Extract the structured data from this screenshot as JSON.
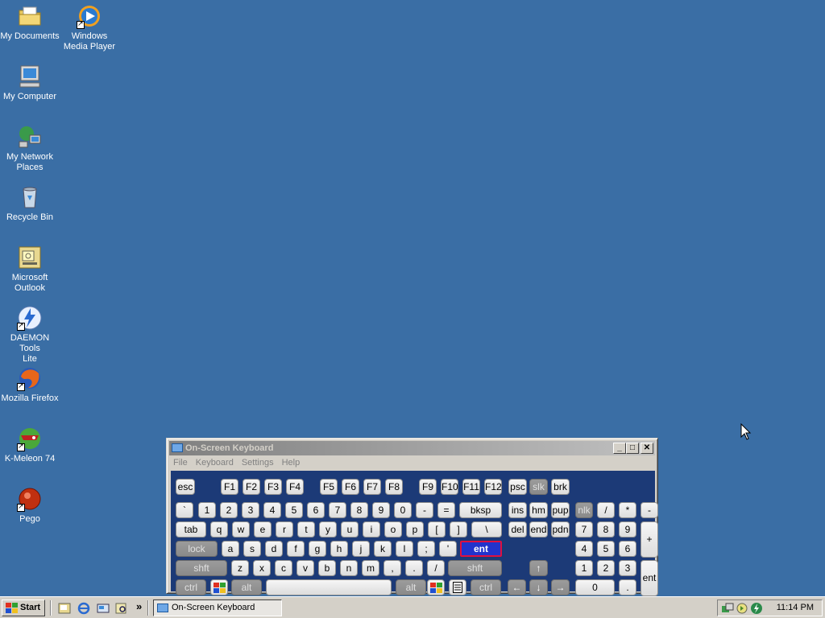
{
  "desktop": {
    "icons": [
      {
        "label": "My Documents"
      },
      {
        "label": "Windows\nMedia Player"
      },
      {
        "label": "My Computer"
      },
      {
        "label": "My Network\nPlaces"
      },
      {
        "label": "Recycle Bin"
      },
      {
        "label": "Microsoft\nOutlook"
      },
      {
        "label": "DAEMON Tools\nLite"
      },
      {
        "label": "Mozilla Firefox"
      },
      {
        "label": "K-Meleon 74"
      },
      {
        "label": "Pego"
      }
    ]
  },
  "window": {
    "title": "On-Screen Keyboard",
    "buttons": {
      "minimize": "_",
      "maximize": "□",
      "close": "✕"
    },
    "menu": [
      "File",
      "Keyboard",
      "Settings",
      "Help"
    ]
  },
  "keyboard": {
    "keys": [
      "esc",
      "F1",
      "F2",
      "F3",
      "F4",
      "F5",
      "F6",
      "F7",
      "F8",
      "F9",
      "F10",
      "F11",
      "F12",
      "psc",
      "slk",
      "brk",
      "`",
      "1",
      "2",
      "3",
      "4",
      "5",
      "6",
      "7",
      "8",
      "9",
      "0",
      "-",
      "=",
      "bksp",
      "ins",
      "hm",
      "pup",
      "nlk",
      "/",
      "*",
      "-",
      "tab",
      "q",
      "w",
      "e",
      "r",
      "t",
      "y",
      "u",
      "i",
      "o",
      "p",
      "[",
      "]",
      "\\",
      "del",
      "end",
      "pdn",
      "7",
      "8",
      "9",
      "+",
      "lock",
      "a",
      "s",
      "d",
      "f",
      "g",
      "h",
      "j",
      "k",
      "l",
      ";",
      "'",
      "ent",
      "4",
      "5",
      "6",
      "shft",
      "z",
      "x",
      "c",
      "v",
      "b",
      "n",
      "m",
      ",",
      ".",
      "/",
      "shft",
      "↑",
      "1",
      "2",
      "3",
      "ent",
      "ctrl",
      "",
      "alt",
      "",
      "alt",
      "",
      "",
      "ctrl",
      "←",
      "↓",
      "→",
      "0",
      "."
    ]
  },
  "taskbar": {
    "start_label": "Start",
    "chevron": "»",
    "task_label": "On-Screen Keyboard",
    "clock": "11:14 PM"
  },
  "colors": {
    "desktop": "#3a6ea5",
    "keyboard_bg": "#1c3a77",
    "highlight_key": "#2233cc"
  }
}
